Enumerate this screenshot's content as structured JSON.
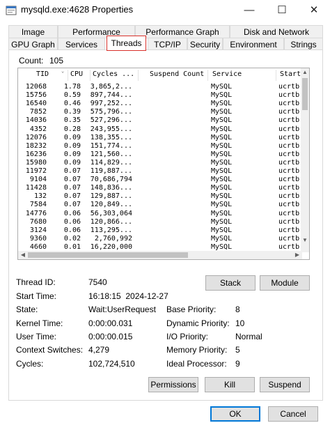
{
  "window": {
    "title": "mysqld.exe:4628 Properties",
    "minimize": "—",
    "maximize": "☐",
    "close": "✕"
  },
  "tabs_row1": [
    "Image",
    "Performance",
    "Performance Graph",
    "Disk and Network"
  ],
  "tabs_row2": [
    "GPU Graph",
    "Services",
    "Threads",
    "TCP/IP",
    "Security",
    "Environment",
    "Strings"
  ],
  "active_tab": "Threads",
  "count": {
    "label": "Count:",
    "value": "105"
  },
  "threads_table": {
    "columns": [
      "TID",
      "CPU",
      "Cycles ...",
      "Suspend Count",
      "Service",
      "Start"
    ],
    "rows": [
      [
        "12068",
        "1.78",
        "3,865,2...",
        "",
        "MySQL",
        "ucrtb"
      ],
      [
        "15756",
        "0.59",
        "897,744...",
        "",
        "MySQL",
        "ucrtb"
      ],
      [
        "16540",
        "0.46",
        "997,252...",
        "",
        "MySQL",
        "ucrtb"
      ],
      [
        "7852",
        "0.39",
        "575,796...",
        "",
        "MySQL",
        "ucrtb"
      ],
      [
        "14036",
        "0.35",
        "527,296...",
        "",
        "MySQL",
        "ucrtb"
      ],
      [
        "4352",
        "0.28",
        "243,955...",
        "",
        "MySQL",
        "ucrtb"
      ],
      [
        "12076",
        "0.09",
        "138,355...",
        "",
        "MySQL",
        "ucrtb"
      ],
      [
        "18232",
        "0.09",
        "151,774...",
        "",
        "MySQL",
        "ucrtb"
      ],
      [
        "16236",
        "0.09",
        "121,560...",
        "",
        "MySQL",
        "ucrtb"
      ],
      [
        "15980",
        "0.09",
        "114,829...",
        "",
        "MySQL",
        "ucrtb"
      ],
      [
        "11972",
        "0.07",
        "119,887...",
        "",
        "MySQL",
        "ucrtb"
      ],
      [
        "9104",
        "0.07",
        "70,686,794",
        "",
        "MySQL",
        "ucrtb"
      ],
      [
        "11428",
        "0.07",
        "148,836...",
        "",
        "MySQL",
        "ucrtb"
      ],
      [
        "132",
        "0.07",
        "129,887...",
        "",
        "MySQL",
        "ucrtb"
      ],
      [
        "7584",
        "0.07",
        "120,849...",
        "",
        "MySQL",
        "ucrtb"
      ],
      [
        "14776",
        "0.06",
        "56,303,064",
        "",
        "MySQL",
        "ucrtb"
      ],
      [
        "7680",
        "0.06",
        "120,866...",
        "",
        "MySQL",
        "ucrtb"
      ],
      [
        "3124",
        "0.06",
        "113,295...",
        "",
        "MySQL",
        "ucrtb"
      ],
      [
        "9360",
        "0.02",
        "2,760,992",
        "",
        "MySQL",
        "ucrtb"
      ],
      [
        "4660",
        "0.01",
        "16,220,000",
        "",
        "MySQL",
        "ucrtb"
      ]
    ]
  },
  "details": {
    "thread_id": {
      "label": "Thread ID:",
      "value": "7540"
    },
    "start_time": {
      "label": "Start Time:",
      "value": "16:18:15  2024-12-27"
    },
    "state": {
      "label": "State:",
      "value": "Wait:UserRequest"
    },
    "kernel_time": {
      "label": "Kernel Time:",
      "value": "0:00:00.031"
    },
    "user_time": {
      "label": "User Time:",
      "value": "0:00:00.015"
    },
    "context_switches": {
      "label": "Context Switches:",
      "value": "4,279"
    },
    "cycles": {
      "label": "Cycles:",
      "value": "102,724,510"
    },
    "base_priority": {
      "label": "Base Priority:",
      "value": "8"
    },
    "dynamic_priority": {
      "label": "Dynamic Priority:",
      "value": "10"
    },
    "io_priority": {
      "label": "I/O Priority:",
      "value": "Normal"
    },
    "memory_priority": {
      "label": "Memory Priority:",
      "value": "5"
    },
    "ideal_processor": {
      "label": "Ideal Processor:",
      "value": "9"
    }
  },
  "buttons": {
    "stack": "Stack",
    "module": "Module",
    "permissions": "Permissions",
    "kill": "Kill",
    "suspend": "Suspend",
    "ok": "OK",
    "cancel": "Cancel"
  },
  "colors": {
    "active_tab_border": "#d9302a",
    "default_button_border": "#0078d7"
  }
}
